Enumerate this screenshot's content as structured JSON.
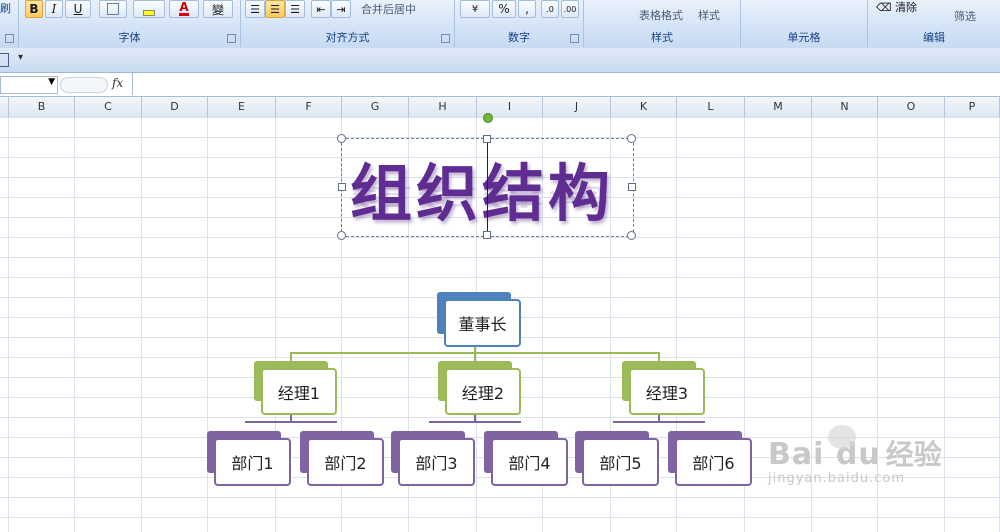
{
  "ribbon": {
    "groups": [
      {
        "label": "字体"
      },
      {
        "label": "对齐方式"
      },
      {
        "label": "数字"
      },
      {
        "label": "样式"
      },
      {
        "label": "单元格"
      },
      {
        "label": "编辑"
      }
    ],
    "buttons": {
      "bold": "B",
      "italic": "I",
      "underline": "U",
      "merge_center": "合并后居中",
      "percent": "%",
      "comma": ",",
      "table_format": "表格格式",
      "cell_style": "样式",
      "clear": "清除",
      "filter": "筛选",
      "left_fragment": "刷",
      "yen_fragment": "變"
    }
  },
  "formula_bar": {
    "fx": "fx"
  },
  "columns": [
    "B",
    "C",
    "D",
    "E",
    "F",
    "G",
    "H",
    "I",
    "J",
    "K",
    "L",
    "M",
    "N",
    "O",
    "P"
  ],
  "wordart": {
    "text": "组织结构"
  },
  "org_chart": {
    "root": "董事长",
    "managers": [
      "经理1",
      "经理2",
      "经理3"
    ],
    "departments": [
      "部门1",
      "部门2",
      "部门3",
      "部门4",
      "部门5",
      "部门6"
    ]
  },
  "watermark": {
    "brand": "Bai du",
    "brand_cn": "经验",
    "url": "jingyan.baidu.com"
  },
  "colors": {
    "root_accent": "#4f81bd",
    "manager_accent": "#9bbb59",
    "department_accent": "#8064a2",
    "wordart": "#5f2d91"
  }
}
